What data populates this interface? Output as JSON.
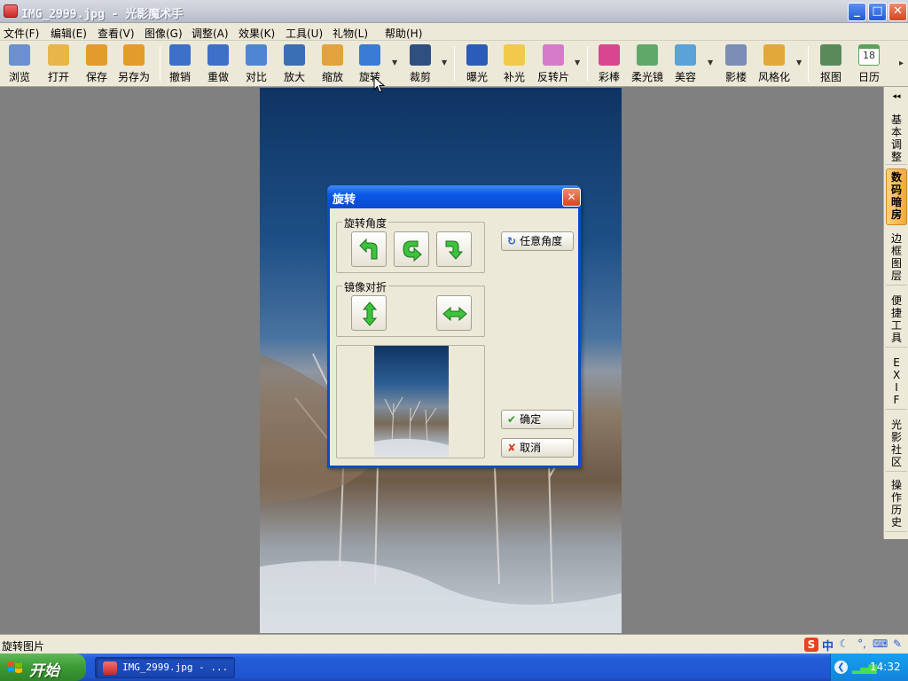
{
  "window": {
    "title": "IMG_2999.jpg - 光影魔术手",
    "minimize": "_",
    "maximize": "□",
    "close": "✕"
  },
  "menu": [
    {
      "label": "文件(F)"
    },
    {
      "label": "编辑(E)"
    },
    {
      "label": "查看(V)"
    },
    {
      "label": "图像(G)"
    },
    {
      "label": "调整(A)"
    },
    {
      "label": "效果(K)"
    },
    {
      "label": "工具(U)"
    },
    {
      "label": "礼物(L)"
    },
    {
      "label": "帮助(H)"
    }
  ],
  "toolbar": [
    {
      "label": "浏览",
      "icon": "eye-icon",
      "color": "#6b8fcf"
    },
    {
      "label": "打开",
      "icon": "folder-icon",
      "color": "#e8b54a"
    },
    {
      "label": "保存",
      "icon": "disk-icon",
      "color": "#e39b2b"
    },
    {
      "label": "另存为",
      "icon": "save-as-icon",
      "color": "#e39b2b"
    },
    {
      "label": "撤销",
      "icon": "undo-icon",
      "color": "#3e6fc9"
    },
    {
      "label": "重做",
      "icon": "redo-icon",
      "color": "#3e6fc9"
    },
    {
      "label": "对比",
      "icon": "compare-icon",
      "color": "#4f86d1"
    },
    {
      "label": "放大",
      "icon": "zoom-in-icon",
      "color": "#3b6fb5"
    },
    {
      "label": "缩放",
      "icon": "resize-icon",
      "color": "#e1a33a"
    },
    {
      "label": "旋转",
      "icon": "rotate-icon",
      "color": "#3a7bd5"
    },
    {
      "label": "裁剪",
      "icon": "crop-icon",
      "color": "#2f4f7f"
    },
    {
      "label": "曝光",
      "icon": "exposure-icon",
      "color": "#2b5db8"
    },
    {
      "label": "补光",
      "icon": "bulb-icon",
      "color": "#f2c94c"
    },
    {
      "label": "反转片",
      "icon": "film-icon",
      "color": "#d67bc9"
    },
    {
      "label": "彩棒",
      "icon": "magic-wand-icon",
      "color": "#d9468f"
    },
    {
      "label": "柔光镜",
      "icon": "soft-lens-icon",
      "color": "#5fa86a"
    },
    {
      "label": "美容",
      "icon": "face-icon",
      "color": "#5aa2d8"
    },
    {
      "label": "影楼",
      "icon": "studio-icon",
      "color": "#7b8db5"
    },
    {
      "label": "风格化",
      "icon": "style-icon",
      "color": "#e0a93a"
    },
    {
      "label": "抠图",
      "icon": "cutout-icon",
      "color": "#5a8a5a"
    },
    {
      "label": "日历",
      "icon": "calendar-icon",
      "color": "#5aa05a",
      "badge": "18"
    }
  ],
  "right_panel": {
    "collapse": "◂◂",
    "tabs": [
      "基本调整",
      "数码暗房",
      "边框图层",
      "便捷工具",
      "EXIF",
      "光影社区",
      "操作历史"
    ],
    "active_index": 1
  },
  "dialog": {
    "title": "旋转",
    "close": "✕",
    "rotate_group": "旋转角度",
    "mirror_group": "镜像对折",
    "any_angle": "任意角度",
    "ok": "确定",
    "cancel": "取消"
  },
  "status": {
    "text": "旋转图片"
  },
  "ime": {
    "logo": "S",
    "mode": "中"
  },
  "taskbar": {
    "start": "开始",
    "item": "IMG_2999.jpg - ...",
    "clock": "14:32"
  }
}
